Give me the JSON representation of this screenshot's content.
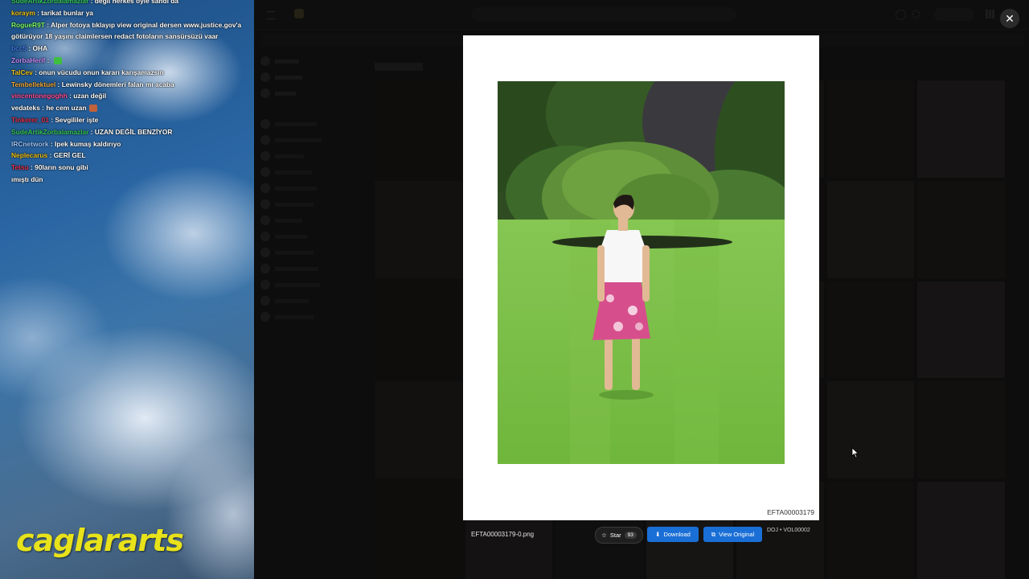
{
  "chat": {
    "lines": [
      {
        "user": "SudeArtikZorbalamazlar",
        "color": "#36c95a",
        "msg": "değil herkes öyle sandı da"
      },
      {
        "user": "koraym",
        "color": "#f0c419",
        "msg": "tarikat bunlar ya"
      },
      {
        "user": "RogueR9T",
        "color": "#7cfc6a",
        "msg": "Alper fotoya tıklayıp view original dersen www.justice.gov'a götürüyor 18 yaşını claimlersen redact fotoların sansürsüzü vaar"
      },
      {
        "user": "bcc5",
        "color": "#3f7ff0",
        "msg": "OHA"
      },
      {
        "user": "ZorbaHerif",
        "color": "#c68cff",
        "msg": ""
      },
      {
        "user": "TalCev",
        "color": "#f0c419",
        "msg": "onun vücudu onun kararı karışamazsın"
      },
      {
        "user": "Tembellektuel",
        "color": "#f0a93a",
        "msg": "Lewinsky dönemleri falan mı acaba"
      },
      {
        "user": "vincentonegoghh",
        "color": "#ff4f9a",
        "msg": "uzan değil"
      },
      {
        "user": "vedateks",
        "color": "#ffffff",
        "msg": "he cem uzan"
      },
      {
        "user": "Tinkerer_01",
        "color": "#e0314b",
        "msg": "Sevgililer işte"
      },
      {
        "user": "SudeArtikZorbalamazlar",
        "color": "#36c95a",
        "msg": "UZAN DEĞİL BENZİYOR"
      },
      {
        "user": "IRCnetwork",
        "color": "#9ec7ff",
        "msg": "Ipek kumaş kaldırıyo"
      },
      {
        "user": "Neplecarus",
        "color": "#f0c419",
        "msg": "GERİ GEL"
      },
      {
        "user": "Tetsu",
        "color": "#e0314b",
        "msg": "90ların sonu gibi"
      },
      {
        "user": "",
        "color": "#ffffff",
        "msg": "ımıştı dün"
      }
    ]
  },
  "logo": {
    "text": "caglararts"
  },
  "modal": {
    "watermark": "EFTA00003179",
    "file_name": "EFTA00003179-0.png",
    "star_label": "Star",
    "star_count": "93",
    "download_label": "Download",
    "view_original_label": "View Original",
    "source": "DOJ • VOL00002"
  },
  "icons": {
    "close": "close-icon",
    "star": "star-icon",
    "download": "download-icon",
    "external": "external-link-icon",
    "cursor": "mouse-cursor-icon"
  },
  "colors": {
    "accent": "#1a6fd6",
    "stream_logo": "#e8e21a"
  }
}
